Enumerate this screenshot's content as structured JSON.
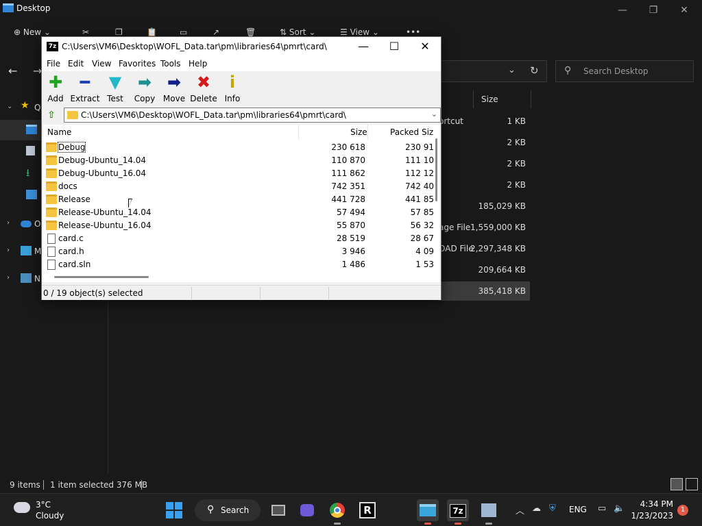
{
  "explorer": {
    "title": "Desktop",
    "window_buttons": {
      "minimize": "—",
      "restore": "❐",
      "close": "✕"
    },
    "commands": {
      "new": "New",
      "sort": "Sort",
      "view": "View",
      "more": "•••"
    },
    "search_placeholder": "Search Desktop",
    "header_size": "Size",
    "sidebar_letters": {
      "quick": "Q",
      "onedrive": "O",
      "thispc": "M",
      "network": "N"
    },
    "rows": [
      {
        "type": "ortcut",
        "size": "1 KB"
      },
      {
        "type": "",
        "size": "2 KB"
      },
      {
        "type": "",
        "size": "2 KB"
      },
      {
        "type": "",
        "size": "2 KB"
      },
      {
        "type": "",
        "size": "185,029 KB"
      },
      {
        "type": "age File",
        "size": "1,559,000 KB"
      },
      {
        "type": "OAD File",
        "size": "2,297,348 KB"
      },
      {
        "type": "",
        "size": "209,664 KB"
      },
      {
        "type": "",
        "size": "385,418 KB"
      }
    ],
    "status": {
      "items": "9 items",
      "selected": "1 item selected  376 MB"
    }
  },
  "sevenzip": {
    "title_icon": "7z",
    "title": "C:\\Users\\VM6\\Desktop\\WOFL_Data.tar\\pm\\libraries64\\pmrt\\card\\",
    "window_buttons": {
      "minimize": "—",
      "maximize": "☐",
      "close": "✕"
    },
    "menu": [
      "File",
      "Edit",
      "View",
      "Favorites",
      "Tools",
      "Help"
    ],
    "toolbar": [
      {
        "label": "Add",
        "glyph": "✚",
        "color": "#1ea51e"
      },
      {
        "label": "Extract",
        "glyph": "━",
        "color": "#1e3fb4"
      },
      {
        "label": "Test",
        "glyph": "▼",
        "color": "#22b8c8"
      },
      {
        "label": "Copy",
        "glyph": "➡",
        "color": "#1f8f8f"
      },
      {
        "label": "Move",
        "glyph": "➡",
        "color": "#12208a"
      },
      {
        "label": "Delete",
        "glyph": "✖",
        "color": "#d41a1a"
      },
      {
        "label": "Info",
        "glyph": "i",
        "color": "#c8a400"
      }
    ],
    "address": "C:\\Users\\VM6\\Desktop\\WOFL_Data.tar\\pm\\libraries64\\pmrt\\card\\",
    "columns": {
      "name": "Name",
      "size": "Size",
      "packed": "Packed Siz"
    },
    "files": [
      {
        "name": "Debug",
        "kind": "folder",
        "size": "230 618",
        "packed": "230 91"
      },
      {
        "name": "Debug-Ubuntu_14.04",
        "kind": "folder",
        "size": "110 870",
        "packed": "111 10"
      },
      {
        "name": "Debug-Ubuntu_16.04",
        "kind": "folder",
        "size": "111 862",
        "packed": "112 12"
      },
      {
        "name": "docs",
        "kind": "folder",
        "size": "742 351",
        "packed": "742 40"
      },
      {
        "name": "Release",
        "kind": "folder",
        "size": "441 728",
        "packed": "441 85"
      },
      {
        "name": "Release-Ubuntu_14.04",
        "kind": "folder",
        "size": "57 494",
        "packed": "57 85"
      },
      {
        "name": "Release-Ubuntu_16.04",
        "kind": "folder",
        "size": "55 870",
        "packed": "56 32"
      },
      {
        "name": "card.c",
        "kind": "file",
        "size": "28 519",
        "packed": "28 67"
      },
      {
        "name": "card.h",
        "kind": "file",
        "size": "3 946",
        "packed": "4 09"
      },
      {
        "name": "card.sln",
        "kind": "file",
        "size": "1 486",
        "packed": "1 53"
      }
    ],
    "status": "0 / 19 object(s) selected"
  },
  "taskbar": {
    "weather": {
      "temp": "3°C",
      "condition": "Cloudy"
    },
    "search_label": "Search",
    "apps": {
      "sevenzip_label": "7z",
      "rider_label": "R"
    },
    "language": "ENG",
    "time": "4:34 PM",
    "date": "1/23/2023",
    "notifications": "1"
  }
}
